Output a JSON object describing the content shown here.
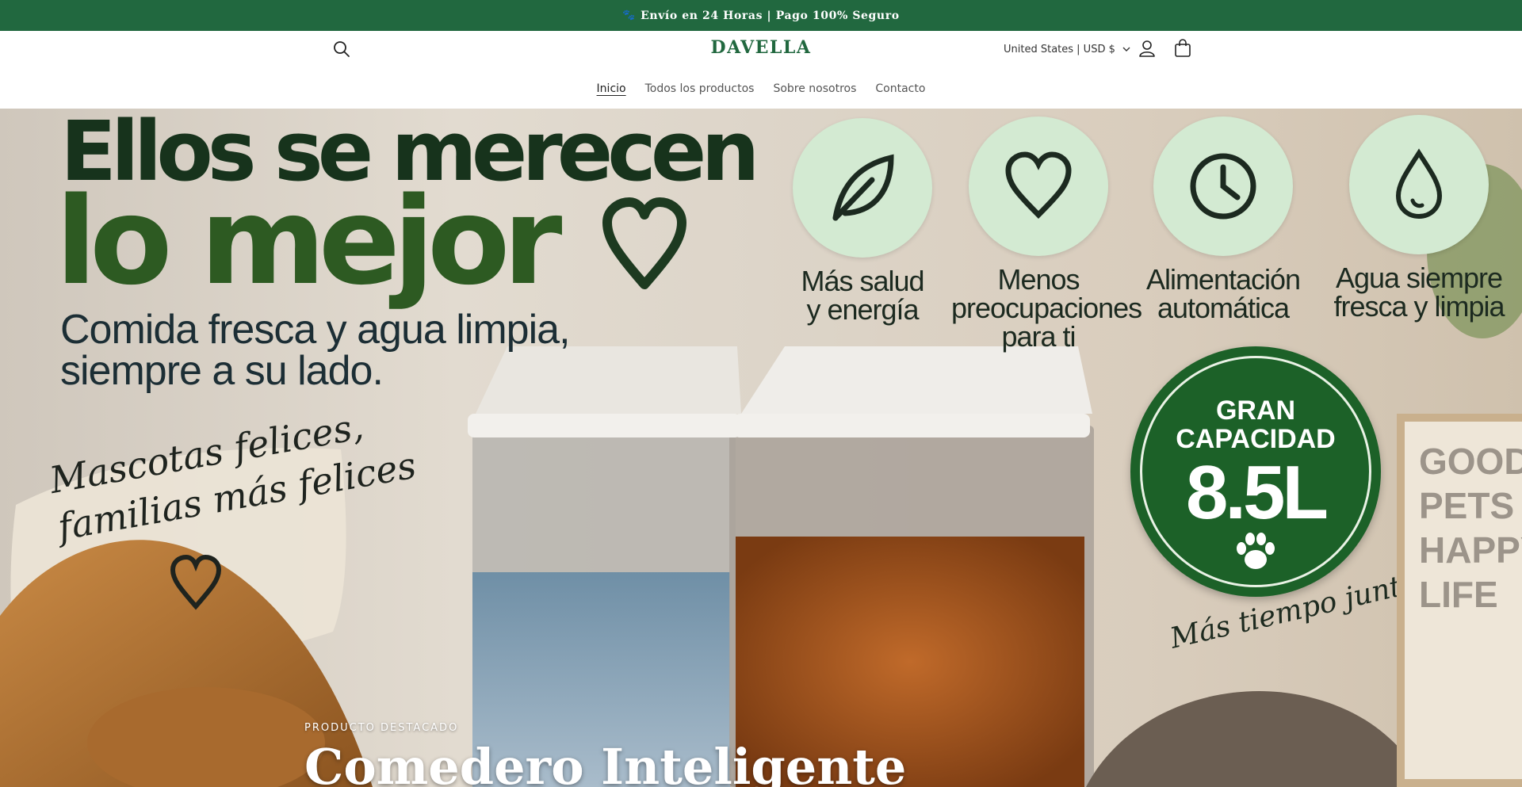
{
  "announcement": {
    "icon": "paw-icon",
    "text": "Envío en 24 Horas | Pago 100% Seguro"
  },
  "header": {
    "logo": "DAVELLA",
    "locale": "United States | USD $",
    "nav": [
      {
        "label": "Inicio",
        "active": true
      },
      {
        "label": "Todos los productos",
        "active": false
      },
      {
        "label": "Sobre nosotros",
        "active": false
      },
      {
        "label": "Contacto",
        "active": false
      }
    ],
    "icons": {
      "search": "search-icon",
      "account": "user-icon",
      "cart": "cart-icon"
    }
  },
  "hero": {
    "headline_1": "Ellos se merecen",
    "headline_2": "lo mejor",
    "sub_1": "Comida fresca y agua limpia,",
    "sub_2": "siempre a su lado.",
    "brush_1": "Mascotas felices,",
    "brush_2": "familias más felices",
    "features": [
      {
        "icon": "leaf-icon",
        "line1": "Más salud",
        "line2": "y energía",
        "line3": ""
      },
      {
        "icon": "heart-icon",
        "line1": "Menos",
        "line2": "preocupaciones",
        "line3": "para ti"
      },
      {
        "icon": "clock-icon",
        "line1": "Alimentación",
        "line2": "automática",
        "line3": ""
      },
      {
        "icon": "drop-icon",
        "line1": "Agua siempre",
        "line2": "fresca y limpia",
        "line3": ""
      }
    ],
    "badge": {
      "line1": "GRAN",
      "line2": "CAPACIDAD",
      "volume": "8.5L"
    },
    "tagline": "Más tiempo juntos",
    "sign": "GOOD\nPETS\nHAPPY\nLIFE",
    "eyebrow": "PRODUCTO DESTACADO",
    "title": "Comedero Inteligente"
  },
  "colors": {
    "brand": "#21683f",
    "badge": "#1c6128",
    "feature_circle": "#d3ead2"
  }
}
